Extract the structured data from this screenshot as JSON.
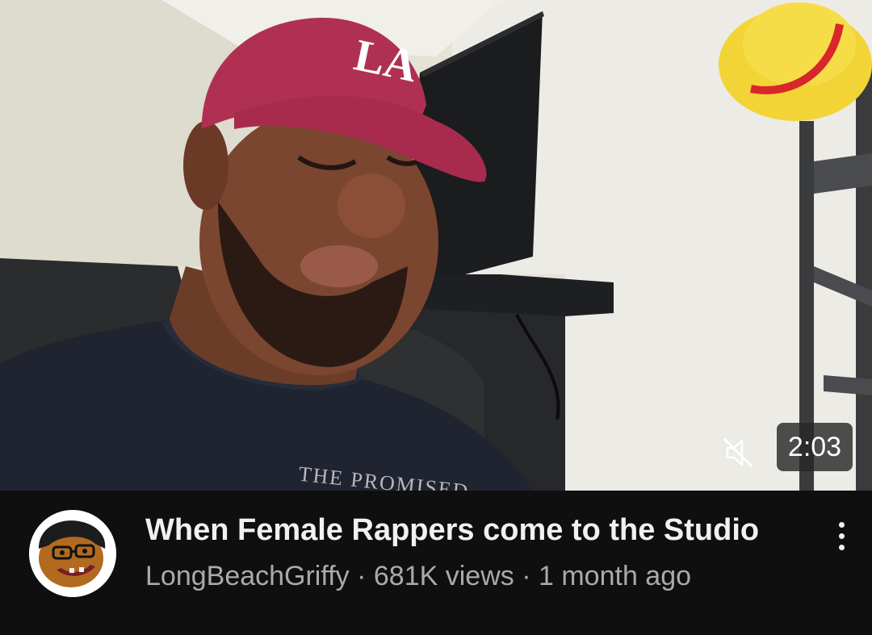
{
  "video": {
    "duration": "2:03",
    "title": "When Female Rappers come to the Studio",
    "channel": "LongBeachGriffy",
    "separator": "·",
    "views": "681K views",
    "age": "1 month ago"
  },
  "thumbnail": {
    "shirt_text": "THE PROMISED",
    "cap_logo": "LA"
  },
  "icons": {
    "mute": "muted-speaker-icon",
    "menu": "more-vert-icon"
  },
  "colors": {
    "background": "#0f0f0f",
    "title": "#f1f1f1",
    "meta": "#aaaaaa",
    "cap": "#b03054"
  }
}
